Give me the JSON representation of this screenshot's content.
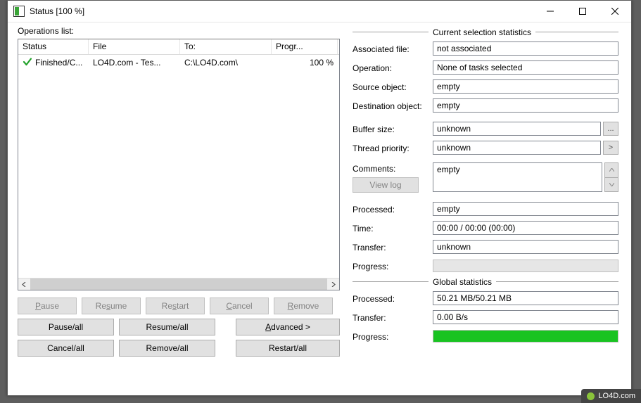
{
  "window": {
    "title": "Status [100 %]"
  },
  "left": {
    "operations_label": "Operations list:",
    "columns": {
      "status": "Status",
      "file": "File",
      "to": "To:",
      "progress": "Progr..."
    },
    "rows": [
      {
        "status": "Finished/C...",
        "file": "LO4D.com - Tes...",
        "to": "C:\\LO4D.com\\",
        "progress": "100 %"
      }
    ],
    "buttons": {
      "pause": "Pause",
      "resume": "Resume",
      "restart": "Restart",
      "cancel": "Cancel",
      "remove": "Remove",
      "pause_all": "Pause/all",
      "resume_all": "Resume/all",
      "advanced": "Advanced >",
      "cancel_all": "Cancel/all",
      "remove_all": "Remove/all",
      "restart_all": "Restart/all"
    }
  },
  "right": {
    "section_current": "Current selection statistics",
    "section_global": "Global statistics",
    "labels": {
      "associated_file": "Associated file:",
      "operation": "Operation:",
      "source_object": "Source object:",
      "destination_object": "Destination object:",
      "buffer_size": "Buffer size:",
      "thread_priority": "Thread priority:",
      "comments": "Comments:",
      "view_log": "View log",
      "processed": "Processed:",
      "time": "Time:",
      "transfer": "Transfer:",
      "progress": "Progress:"
    },
    "values": {
      "associated_file": "not associated",
      "operation": "None of tasks selected",
      "source_object": "empty",
      "destination_object": "empty",
      "buffer_size": "unknown",
      "thread_priority": "unknown",
      "comments": "empty",
      "processed": "empty",
      "time": "00:00 / 00:00 (00:00)",
      "transfer": "unknown",
      "progress_percent": 0
    },
    "global": {
      "processed": "50.21 MB/50.21 MB",
      "transfer": "0.00 B/s",
      "progress_percent": 100
    }
  },
  "watermark": "LO4D.com"
}
